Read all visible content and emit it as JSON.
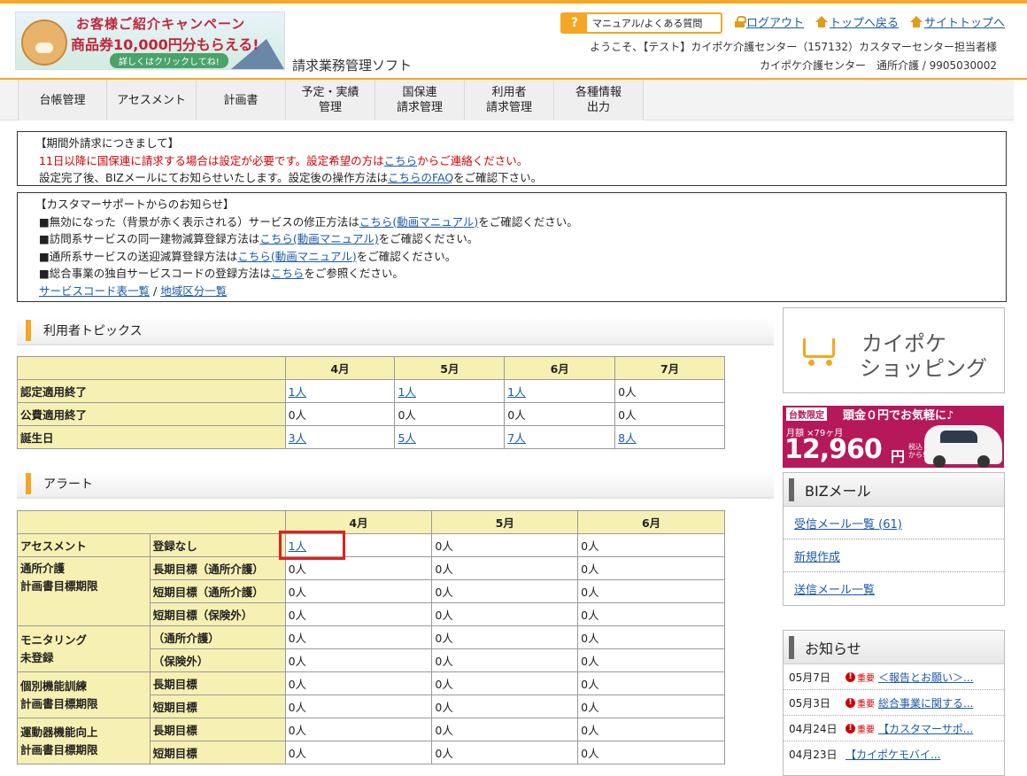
{
  "header": {
    "banner": {
      "line1": "お客様ご紹介キャンペーン",
      "line2": "商品券10,000円分もらえる!",
      "line3": "詳しくはクリックしてね!"
    },
    "app_title": "請求業務管理ソフト",
    "help_button": "マニュアル/よくある質問",
    "help_icon": "?",
    "logout": "ログアウト",
    "top": "トップへ戻る",
    "site_top": "サイトトップへ",
    "welcome": "ようこそ、【テスト】カイポケ介護センター（157132）カスタマーセンター担当者様",
    "office": "カイポケ介護センター　通所介護 / 9905030002"
  },
  "nav": {
    "items": [
      {
        "label": "台帳管理"
      },
      {
        "label": "アセスメント"
      },
      {
        "label": "計画書"
      },
      {
        "label": "予定・実績\n管理"
      },
      {
        "label": "国保連\n請求管理"
      },
      {
        "label": "利用者\n請求管理"
      },
      {
        "label": "各種情報\n出力"
      }
    ]
  },
  "notice1": {
    "title": "【期間外請求につきまして】",
    "red_text": "11日以降に国保連に請求する場合は設定が必要です。設定希望の方は",
    "red_link": "こちら",
    "red_tail": "からご連絡ください。",
    "line2": "設定完了後、BIZメールにてお知らせいたします。設定後の操作方法は",
    "line2_link": "こちらのFAQ",
    "line2_tail": "をご確認下さい。"
  },
  "notice2": {
    "title": "【カスタマーサポートからのお知らせ】",
    "l1": "■無効になった（背景が赤く表示される）サービスの修正方法は",
    "l1_link": "こちら(動画マニュアル)",
    "l1_tail": "をご確認ください。",
    "l2": "■訪問系サービスの同一建物減算登録方法は",
    "l2_link": "こちら(動画マニュアル)",
    "l2_tail": "をご確認ください。",
    "l3": "■通所系サービスの送迎減算登録方法は",
    "l3_link": "こちら(動画マニュアル)",
    "l3_tail": "をご確認ください。",
    "l4": "■総合事業の独自サービスコードの登録方法は",
    "l4_link": "こちら",
    "l4_tail": "をご参照ください。",
    "link_a": "サービスコード表一覧",
    "sep": "/",
    "link_b": "地域区分一覧"
  },
  "topics": {
    "title": "利用者トピックス",
    "months": [
      "4月",
      "5月",
      "6月",
      "7月"
    ],
    "rows": [
      {
        "label": "認定適用終了",
        "values": [
          "1人",
          "1人",
          "1人",
          "0人"
        ]
      },
      {
        "label": "公費適用終了",
        "values": [
          "0人",
          "0人",
          "0人",
          "0人"
        ]
      },
      {
        "label": "誕生日",
        "values": [
          "3人",
          "5人",
          "7人",
          "8人"
        ]
      }
    ]
  },
  "alerts": {
    "title": "アラート",
    "months": [
      "4月",
      "5月",
      "6月"
    ],
    "groups": [
      {
        "label": "アセスメント",
        "rows": [
          {
            "sub": "登録なし",
            "values": [
              "1人",
              "0人",
              "0人"
            ]
          }
        ]
      },
      {
        "label": "通所介護\n計画書目標期限",
        "rows": [
          {
            "sub": "長期目標（通所介護）",
            "values": [
              "0人",
              "0人",
              "0人"
            ]
          },
          {
            "sub": "短期目標（通所介護）",
            "values": [
              "0人",
              "0人",
              "0人"
            ]
          },
          {
            "sub": "短期目標（保険外）",
            "values": [
              "0人",
              "0人",
              "0人"
            ]
          }
        ]
      },
      {
        "label": "モニタリング\n未登録",
        "rows": [
          {
            "sub": "（通所介護）",
            "values": [
              "0人",
              "0人",
              "0人"
            ]
          },
          {
            "sub": "（保険外）",
            "values": [
              "0人",
              "0人",
              "0人"
            ]
          }
        ]
      },
      {
        "label": "個別機能訓練\n計画書目標期限",
        "rows": [
          {
            "sub": "長期目標",
            "values": [
              "0人",
              "0人",
              "0人"
            ]
          },
          {
            "sub": "短期目標",
            "values": [
              "0人",
              "0人",
              "0人"
            ]
          }
        ]
      },
      {
        "label": "運動器機能向上\n計画書目標期限",
        "rows": [
          {
            "sub": "長期目標",
            "values": [
              "0人",
              "0人",
              "0人"
            ]
          },
          {
            "sub": "短期目標",
            "values": [
              "0人",
              "0人",
              "0人"
            ]
          }
        ]
      }
    ]
  },
  "sidebar": {
    "shop_line1": "カイポケ",
    "shop_line2": "ショッピング",
    "car_ad": {
      "tag": "台数限定",
      "headline": "頭金０円でお気軽に♪",
      "monthly": "月額 ×79ヶ月",
      "price": "12,960",
      "yen": "円",
      "tax": "税込\nから!"
    },
    "biz": {
      "title": "BIZメール",
      "items": [
        "受信メール一覧 (61)",
        "新規作成",
        "送信メール一覧"
      ]
    },
    "news": {
      "title": "お知らせ",
      "important_icon": "!",
      "items": [
        {
          "date": "05月7日",
          "important": "重要",
          "text": "＜報告とお願い＞..."
        },
        {
          "date": "05月3日",
          "important": "重要",
          "text": "総合事業に関する..."
        },
        {
          "date": "04月24日",
          "important": "重要",
          "text": "【カスタマーサポ..."
        },
        {
          "date": "04月23日",
          "important": "",
          "text": "【カイポケモバイ..."
        }
      ]
    }
  }
}
